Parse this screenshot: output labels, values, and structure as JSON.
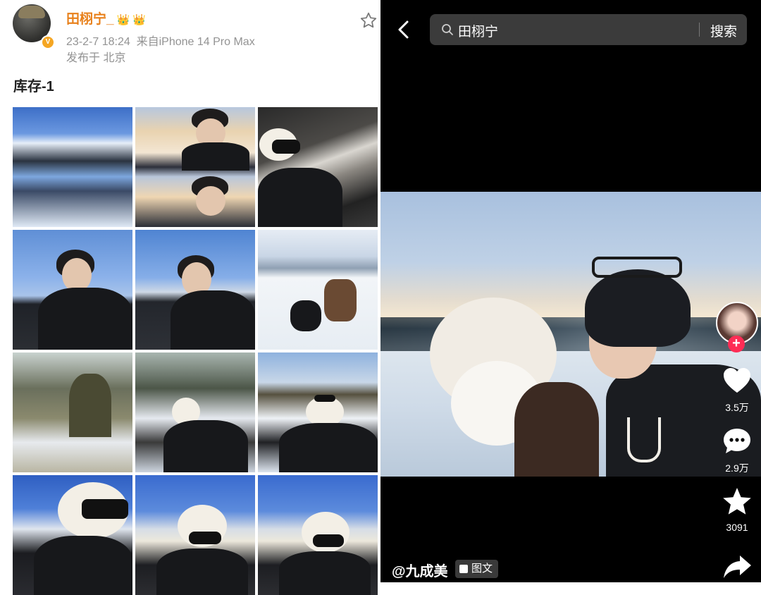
{
  "weibo_post": {
    "username": "田栩宁_",
    "crown_icons": [
      "👑",
      "👑"
    ],
    "timestamp": "23-2-7 18:24",
    "source": "来自iPhone 14 Pro Max",
    "location": "发布于 北京",
    "text": "库存-1",
    "photos": [
      {
        "alt": "mountain-snow-photo"
      },
      {
        "alt": "sunset-selfie-photo"
      },
      {
        "alt": "car-selfie-photo"
      },
      {
        "alt": "sky-selfie-photo"
      },
      {
        "alt": "sky-selfie-photo"
      },
      {
        "alt": "reindeer-photo"
      },
      {
        "alt": "forest-photo"
      },
      {
        "alt": "forest-lying-photo"
      },
      {
        "alt": "forest-snow-photo"
      },
      {
        "alt": "earmuff-selfie-photo"
      },
      {
        "alt": "earmuff-selfie-photo"
      },
      {
        "alt": "earmuff-selfie-photo"
      }
    ]
  },
  "douyin_view": {
    "search_query": "田栩宁",
    "search_button": "搜索",
    "likes": "3.5万",
    "comments": "2.9万",
    "favorites": "3091",
    "author": "@九成美",
    "post_type": "图文",
    "accent_color": "#fe2c55"
  }
}
